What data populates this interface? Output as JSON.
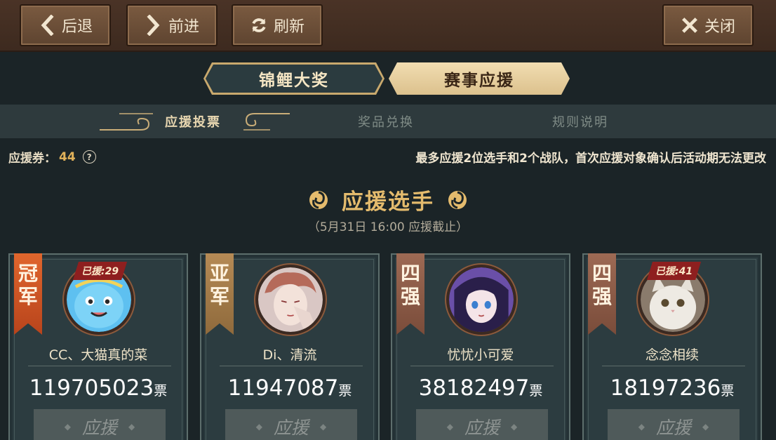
{
  "toolbar": {
    "back_label": "后退",
    "forward_label": "前进",
    "refresh_label": "刷新",
    "close_label": "关闭"
  },
  "main_tabs": [
    {
      "label": "锦鲤大奖",
      "active": false
    },
    {
      "label": "赛事应援",
      "active": true
    }
  ],
  "sub_tabs": [
    {
      "label": "应援投票",
      "active": true
    },
    {
      "label": "奖品兑换",
      "active": false
    },
    {
      "label": "规则说明",
      "active": false
    }
  ],
  "coupon": {
    "label": "应援券：",
    "count": "44"
  },
  "notice": "最多应援2位选手和2个战队，首次应援对象确认后活动期无法更改",
  "section": {
    "title": "应援选手",
    "deadline": "（5月31日 16:00 应援截止）"
  },
  "players": [
    {
      "rank": "冠军",
      "rank_chars": [
        "冠",
        "军"
      ],
      "badge": "已援:29",
      "name": "CC、大猫真的菜",
      "votes": "119705023",
      "unit": "票",
      "button": "应援"
    },
    {
      "rank": "亚军",
      "rank_chars": [
        "亚",
        "军"
      ],
      "badge": "",
      "name": "Di、清流",
      "votes": "11947087",
      "unit": "票",
      "button": "应援"
    },
    {
      "rank": "四强",
      "rank_chars": [
        "四",
        "强"
      ],
      "badge": "",
      "name": "忧忧小可爱",
      "votes": "38182497",
      "unit": "票",
      "button": "应援"
    },
    {
      "rank": "四强",
      "rank_chars": [
        "四",
        "强"
      ],
      "badge": "已援:41",
      "name": "念念相续",
      "votes": "18197236",
      "unit": "票",
      "button": "应援"
    }
  ],
  "colors": {
    "accent_gold": "#e4bb6d",
    "champion_tag": "#d9582a",
    "badge_red": "#8e1f1f",
    "button_disabled": "#4f5a5a"
  },
  "icons": {
    "back": "chevron-left-icon",
    "forward": "chevron-right-icon",
    "refresh": "refresh-icon",
    "close": "close-x-icon",
    "help": "question-circle-icon",
    "ornament": "swirl-ornament-icon"
  }
}
